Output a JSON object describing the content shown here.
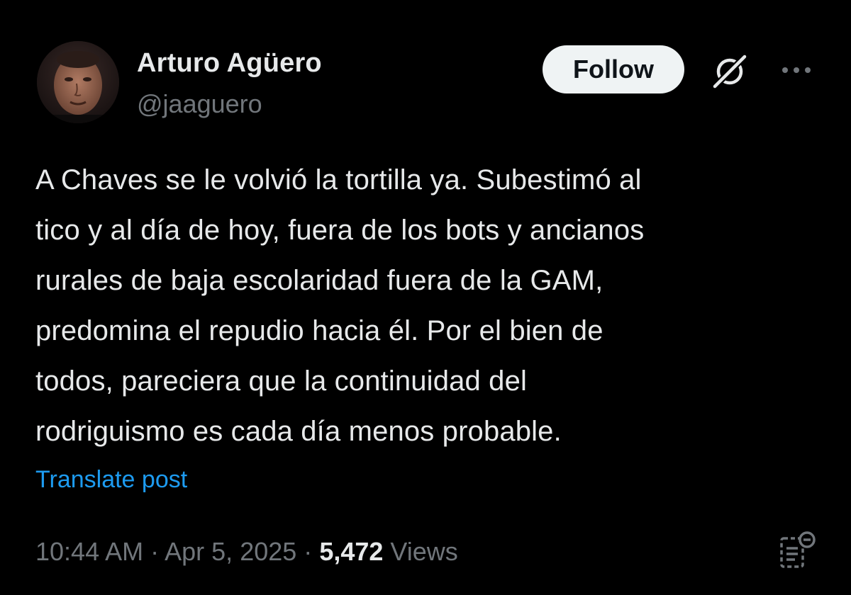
{
  "author": {
    "name": "Arturo Agüero",
    "handle": "@jaaguero"
  },
  "actions": {
    "follow_label": "Follow",
    "grok_icon": "grok-icon",
    "more_icon": "more-horizontal-icon"
  },
  "post": {
    "lines": [
      "A Chaves se le volvió la tortilla ya. Subestimó al",
      "tico y al día de hoy, fuera de los bots y ancianos",
      "rurales de baja escolaridad fuera de la GAM,",
      "predomina el repudio hacia él. Por el bien de",
      "todos, pareciera que la continuidad del",
      "rodriguismo es cada día menos probable."
    ],
    "translate_label": "Translate post"
  },
  "meta": {
    "time": "10:44 AM",
    "separator": "·",
    "date": "Apr 5, 2025",
    "views_count": "5,472",
    "views_label": "Views",
    "stats_icon": "post-analytics-icon"
  },
  "colors": {
    "background": "#000000",
    "primary_text": "#e7e9ea",
    "secondary_text": "#71767b",
    "link": "#1d9bf0",
    "follow_bg": "#eff3f4"
  }
}
